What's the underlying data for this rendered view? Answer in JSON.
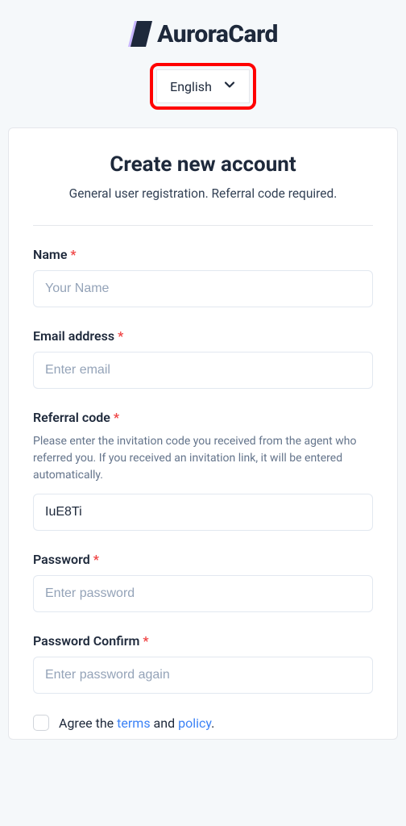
{
  "brand": {
    "name": "AuroraCard"
  },
  "lang": {
    "selected": "English"
  },
  "form": {
    "title": "Create new account",
    "subtitle": "General user registration. Referral code required.",
    "name": {
      "label": "Name",
      "placeholder": "Your Name",
      "value": ""
    },
    "email": {
      "label": "Email address",
      "placeholder": "Enter email",
      "value": ""
    },
    "referral": {
      "label": "Referral code",
      "placeholder": "",
      "value": "IuE8Ti",
      "help": "Please enter the invitation code you received from the agent who referred you. If you received an invitation link, it will be entered automatically."
    },
    "password": {
      "label": "Password",
      "placeholder": "Enter password",
      "value": ""
    },
    "confirm": {
      "label": "Password Confirm",
      "placeholder": "Enter password again",
      "value": ""
    },
    "agree": {
      "prefix": "Agree the ",
      "terms": "terms",
      "mid": " and ",
      "policy": "policy",
      "suffix": "."
    }
  }
}
